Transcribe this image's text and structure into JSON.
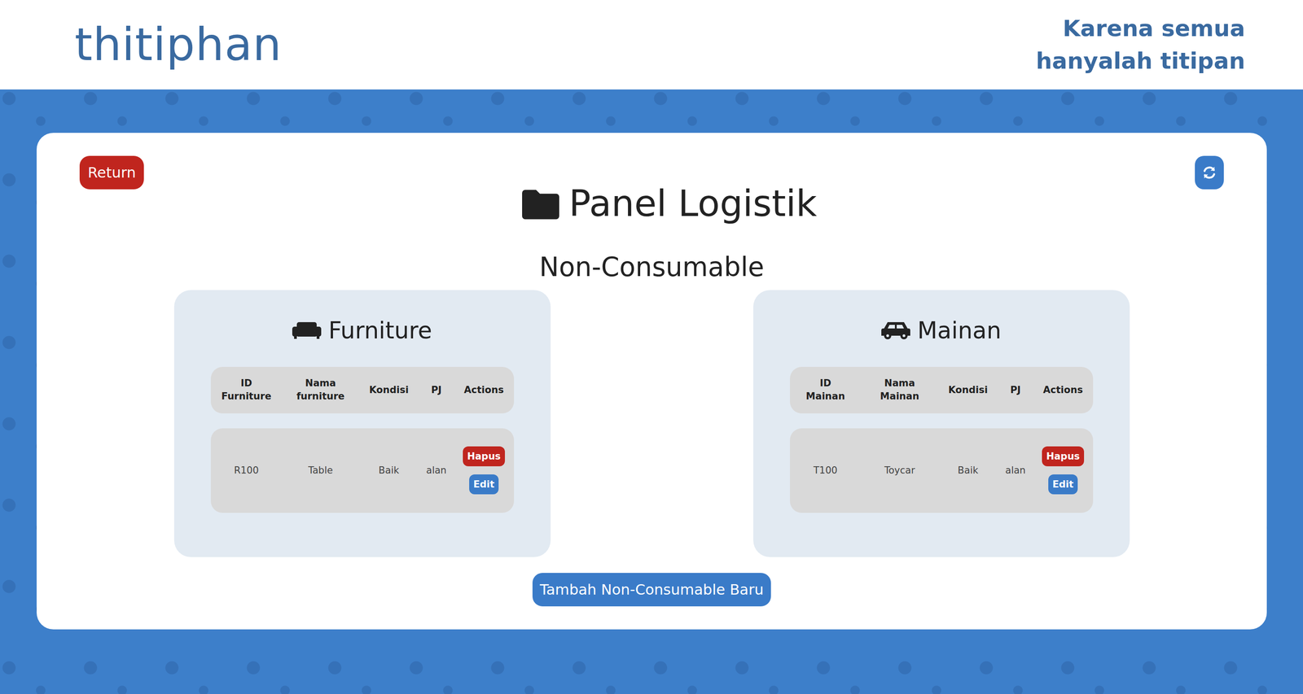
{
  "header": {
    "logo": "thitiphan",
    "tagline": [
      "Karena semua",
      "hanyalah titipan"
    ]
  },
  "return_button": "Return",
  "title": "Panel Logistik",
  "subtitle": "Non-Consumable",
  "panels": [
    {
      "title": "Furniture",
      "kind": "furniture",
      "columns": [
        "ID Furniture",
        "Nama furniture",
        "Kondisi",
        "PJ",
        "Actions"
      ],
      "rows": [
        {
          "cells": [
            "R100",
            "Table",
            "Baik",
            "alan"
          ],
          "actions": [
            {
              "label": "Hapus",
              "kind": "delete"
            },
            {
              "label": "Edit",
              "kind": "edit"
            }
          ]
        }
      ]
    },
    {
      "title": "Mainan",
      "kind": "toy",
      "columns": [
        "ID Mainan",
        "Nama Mainan",
        "Kondisi",
        "PJ",
        "Actions"
      ],
      "rows": [
        {
          "cells": [
            "T100",
            "Toycar",
            "Baik",
            "alan"
          ],
          "actions": [
            {
              "label": "Hapus",
              "kind": "delete"
            },
            {
              "label": "Edit",
              "kind": "edit"
            }
          ]
        }
      ]
    }
  ],
  "add_button": "Tambah Non-Consumable Baru"
}
